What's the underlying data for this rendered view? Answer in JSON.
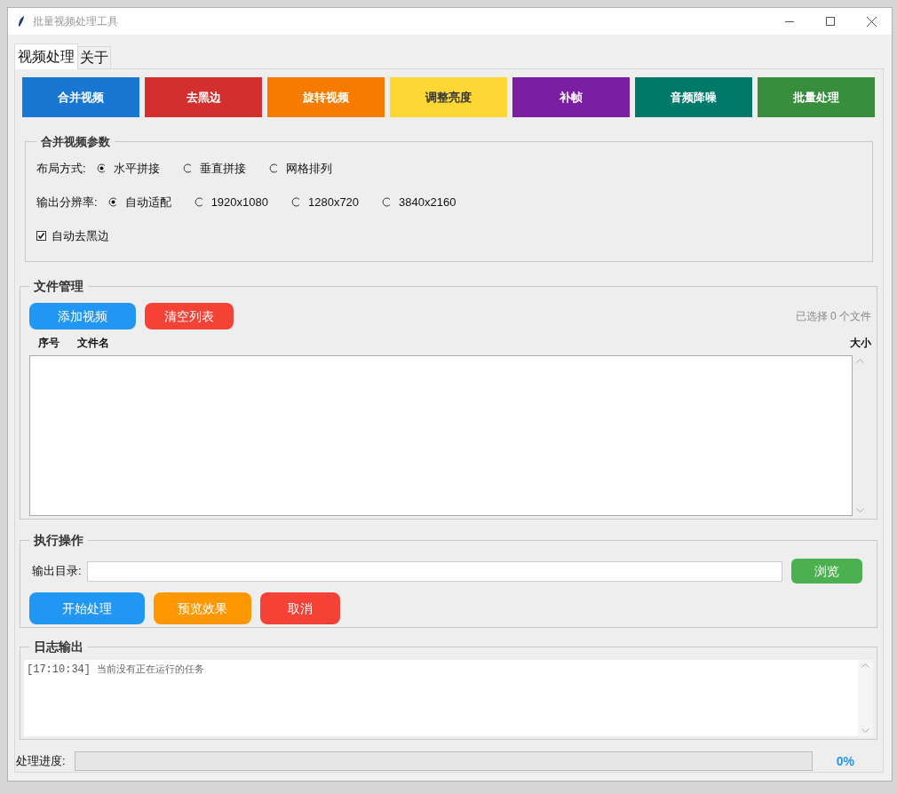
{
  "window": {
    "title": "批量视频处理工具"
  },
  "tabs": [
    {
      "label": "视频处理",
      "selected": true
    },
    {
      "label": "关于",
      "selected": false
    }
  ],
  "tool_buttons": [
    {
      "label": "合并视频",
      "color": "#1976d2"
    },
    {
      "label": "去黑边",
      "color": "#d32f2f"
    },
    {
      "label": "旋转视频",
      "color": "#f57c00"
    },
    {
      "label": "调整亮度",
      "color": "#fdd835"
    },
    {
      "label": "补帧",
      "color": "#7b1fa2"
    },
    {
      "label": "音频降噪",
      "color": "#00796b"
    },
    {
      "label": "批量处理",
      "color": "#388e3c"
    }
  ],
  "merge_params": {
    "title": "合并视频参数",
    "groups": [
      {
        "label": "布局方式:",
        "options": [
          {
            "label": "水平拼接",
            "selected": true
          },
          {
            "label": "垂直拼接",
            "selected": false
          },
          {
            "label": "网格排列",
            "selected": false
          }
        ]
      },
      {
        "label": "输出分辨率:",
        "options": [
          {
            "label": "自动适配",
            "selected": true
          },
          {
            "label": "1920x1080",
            "selected": false
          },
          {
            "label": "1280x720",
            "selected": false
          },
          {
            "label": "3840x2160",
            "selected": false
          }
        ]
      }
    ],
    "checkbox": {
      "label": "自动去黑边",
      "checked": true
    }
  },
  "file_manager": {
    "title": "文件管理",
    "buttons": [
      {
        "label": "添加视频",
        "color": "#2196f3"
      },
      {
        "label": "清空列表",
        "color": "#f44336"
      }
    ],
    "selection_count": "已选择 0 个文件",
    "columns": [
      "序号",
      "文件名",
      "大小"
    ]
  },
  "actions": {
    "title": "执行操作",
    "output_label": "输出目录:",
    "browse_button": {
      "label": "浏览",
      "color": "#4caf50"
    },
    "buttons": [
      {
        "label": "开始处理",
        "color": "#2196f3"
      },
      {
        "label": "预览效果",
        "color": "#ff9800"
      },
      {
        "label": "取消",
        "color": "#f44336"
      }
    ]
  },
  "log": {
    "title": "日志输出",
    "lines": [
      {
        "time": "[17:10:34]",
        "message": "当前没有正在运行的任务"
      }
    ]
  },
  "progress": {
    "label": "处理进度:",
    "level": 0,
    "reading": "0%"
  }
}
